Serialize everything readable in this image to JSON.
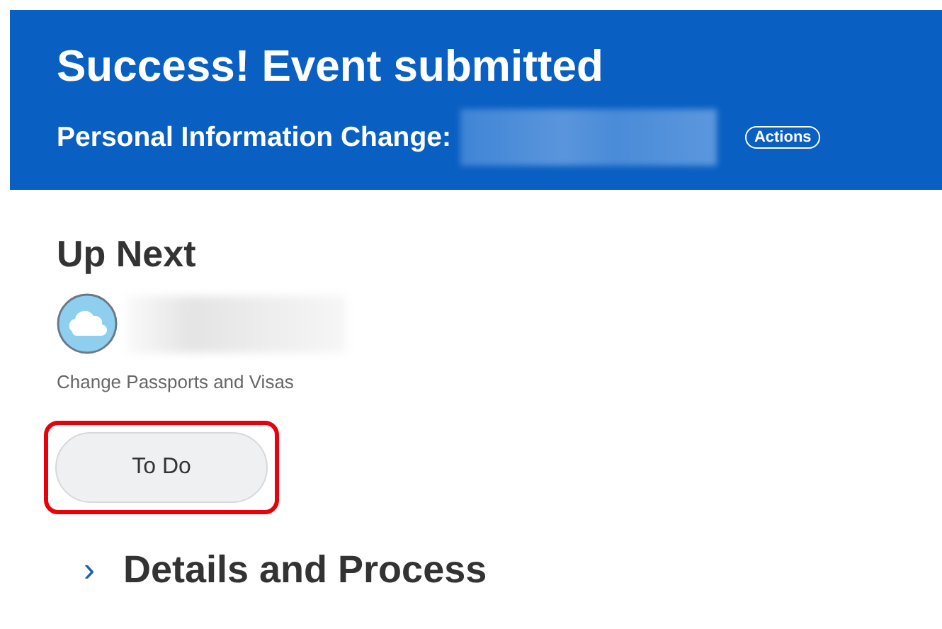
{
  "banner": {
    "title": "Success! Event submitted",
    "subtitle": "Personal Information Change:",
    "actions_button": "Actions"
  },
  "up_next": {
    "heading": "Up Next",
    "task": "Change Passports and Visas",
    "button": "To Do",
    "highlighted": true
  },
  "details": {
    "chevron": "›",
    "heading": "Details and Process",
    "expanded": false
  }
}
